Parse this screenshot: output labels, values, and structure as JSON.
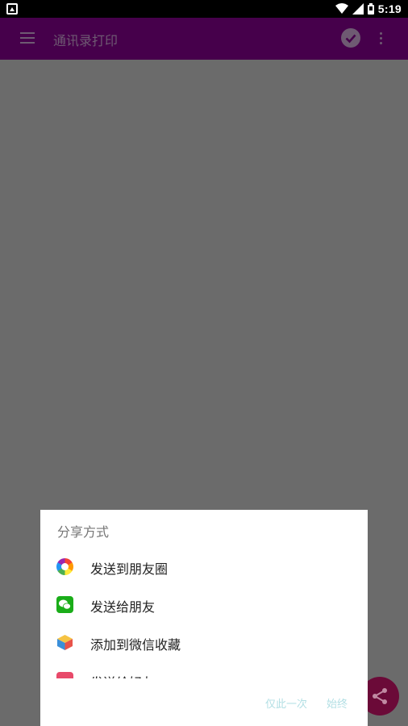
{
  "status_bar": {
    "time": "5:19",
    "icons": [
      "notification-icon",
      "wifi-icon",
      "signal-icon",
      "battery-icon"
    ]
  },
  "app_bar": {
    "title": "通讯录打印",
    "icons": [
      "menu-icon",
      "check-circle-icon",
      "more-vert-icon"
    ]
  },
  "dialog": {
    "title": "分享方式",
    "items": [
      {
        "label": "发送到朋友圈",
        "icon": "moments-icon"
      },
      {
        "label": "发送给朋友",
        "icon": "wechat-icon"
      },
      {
        "label": "添加到微信收藏",
        "icon": "favorites-icon"
      },
      {
        "label": "发送给好友",
        "icon": "contact-icon"
      }
    ],
    "actions": {
      "once": "仅此一次",
      "always": "始终"
    }
  },
  "fab": {
    "icon": "share-icon"
  },
  "colors": {
    "app_bar": "#46004b",
    "scrim": "#6b6b6b",
    "fab": "#6b0a38",
    "action_text": "#b2dfe4"
  }
}
